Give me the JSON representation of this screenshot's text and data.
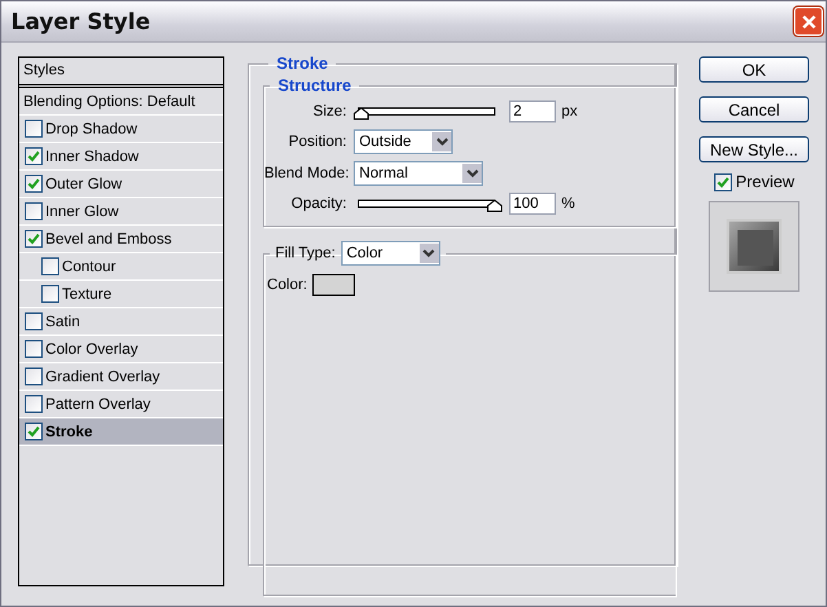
{
  "window": {
    "title": "Layer Style"
  },
  "styles_list": {
    "header": "Styles",
    "blending_options": "Blending Options: Default",
    "items": [
      {
        "label": "Drop Shadow",
        "checked": false,
        "selected": false
      },
      {
        "label": "Inner Shadow",
        "checked": true,
        "selected": false
      },
      {
        "label": "Outer Glow",
        "checked": true,
        "selected": false
      },
      {
        "label": "Inner Glow",
        "checked": false,
        "selected": false
      },
      {
        "label": "Bevel and Emboss",
        "checked": true,
        "selected": false,
        "children": [
          {
            "label": "Contour",
            "checked": false,
            "selected": false
          },
          {
            "label": "Texture",
            "checked": false,
            "selected": false
          }
        ]
      },
      {
        "label": "Satin",
        "checked": false,
        "selected": false
      },
      {
        "label": "Color Overlay",
        "checked": false,
        "selected": false
      },
      {
        "label": "Gradient Overlay",
        "checked": false,
        "selected": false
      },
      {
        "label": "Pattern Overlay",
        "checked": false,
        "selected": false
      },
      {
        "label": "Stroke",
        "checked": true,
        "selected": true
      }
    ]
  },
  "stroke": {
    "title": "Stroke",
    "structure": {
      "title": "Structure",
      "rows": [
        {
          "kind": "slider",
          "label": "Size:",
          "level": 0.01,
          "value": "2",
          "unit": "px"
        },
        {
          "kind": "dropdown",
          "label": "Position:",
          "value": "Outside"
        },
        {
          "kind": "dropdown",
          "label": "Blend Mode:",
          "value": "Normal"
        },
        {
          "kind": "slider",
          "label": "Opacity:",
          "level": 1,
          "value": "100",
          "unit": "%"
        }
      ]
    },
    "fill": {
      "label": "Fill Type:",
      "value": "Color",
      "color_label": "Color:",
      "color": "#d4d4d4"
    }
  },
  "buttons": [
    {
      "label": "OK"
    },
    {
      "label": "Cancel"
    },
    {
      "label": "New Style..."
    }
  ],
  "preview": {
    "label": "Preview",
    "checked": true
  }
}
